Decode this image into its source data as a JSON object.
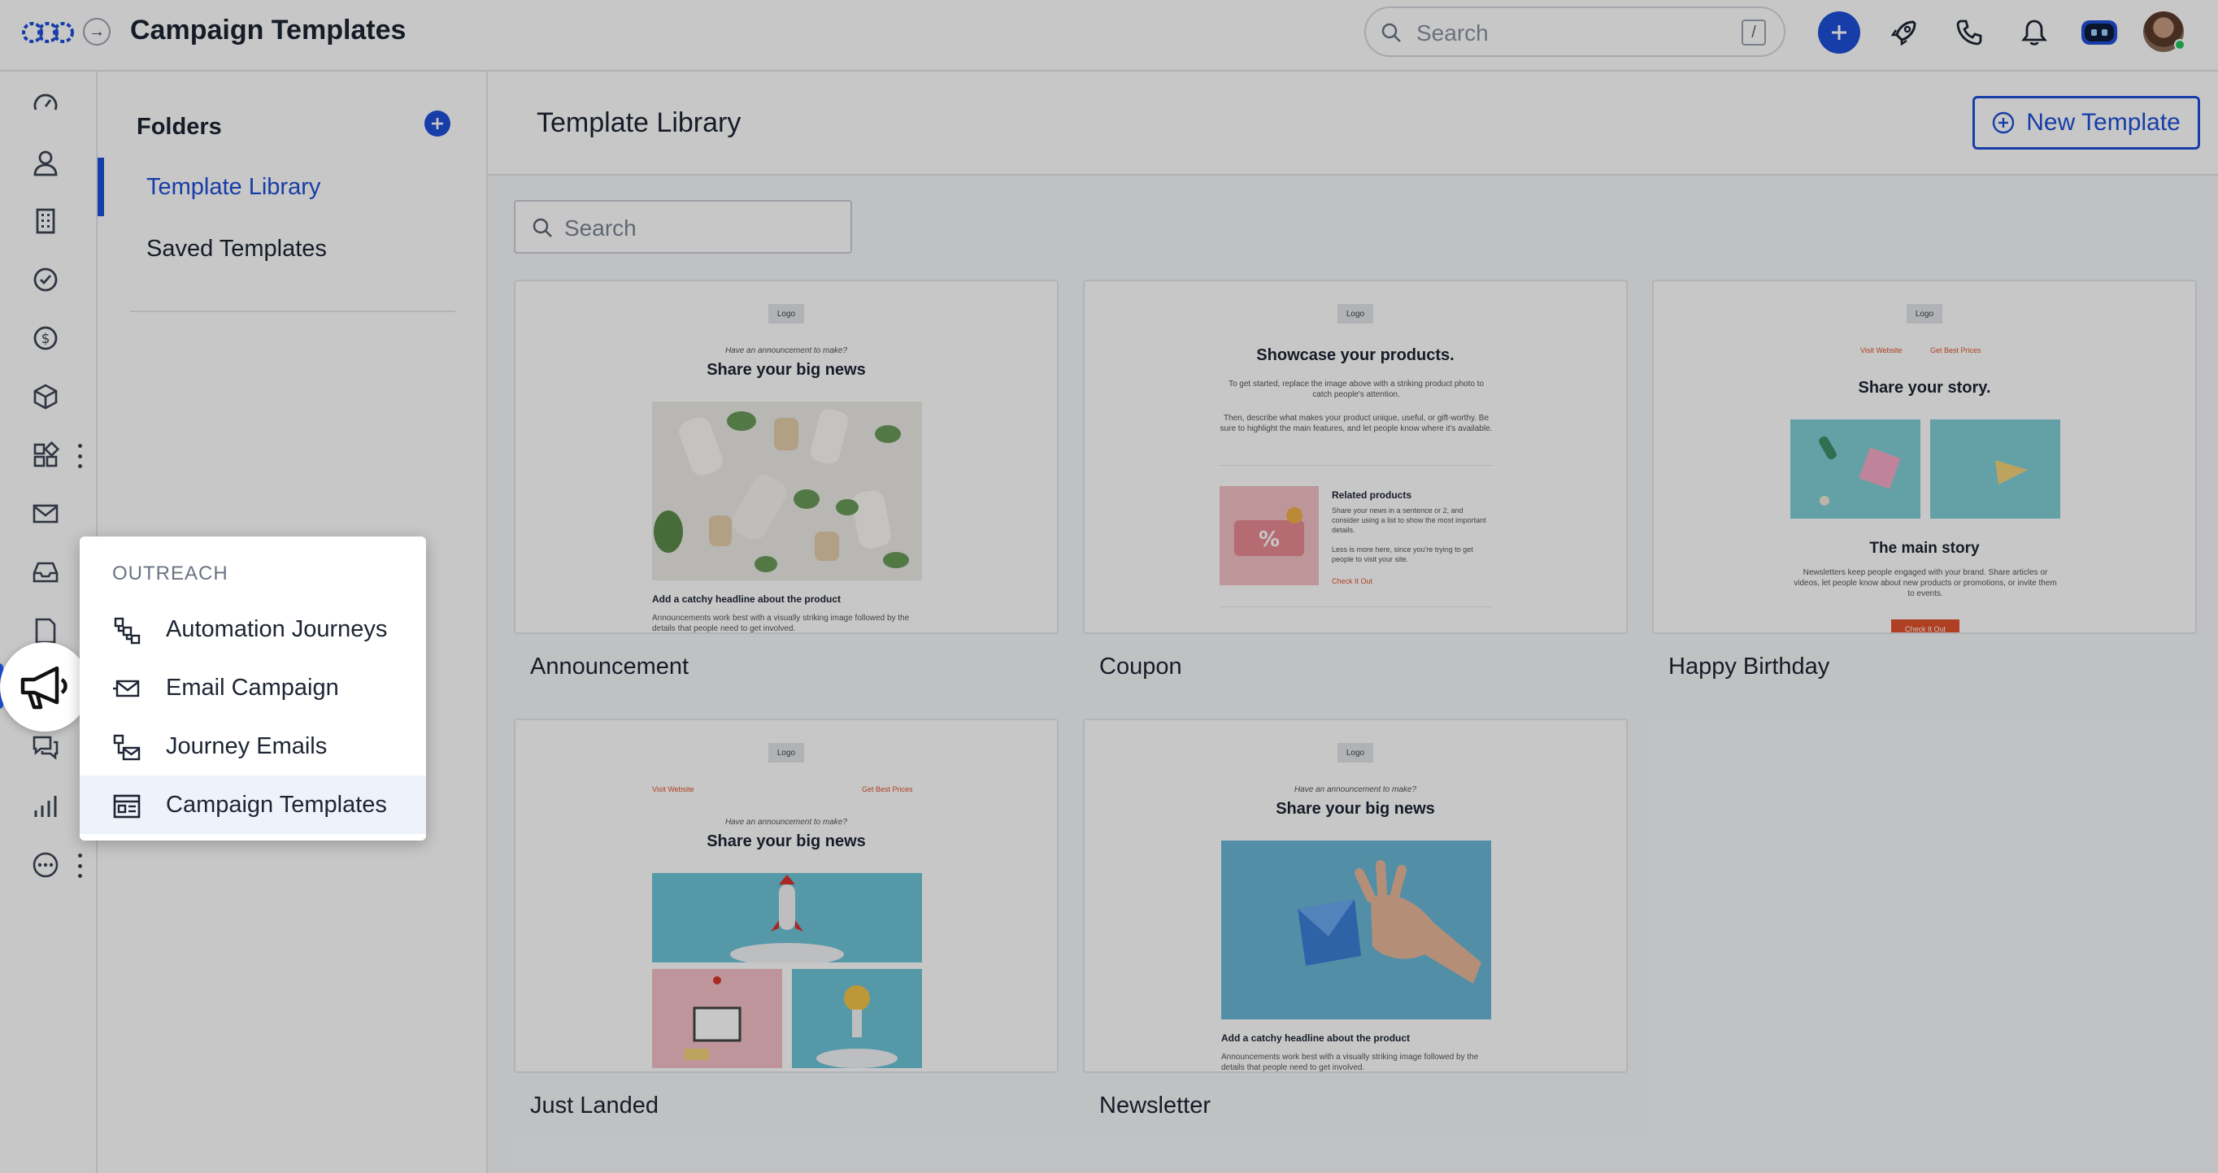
{
  "header": {
    "title": "Campaign Templates",
    "search_placeholder": "Search",
    "search_shortcut": "/"
  },
  "folders": {
    "title": "Folders",
    "items": [
      {
        "label": "Template Library",
        "active": true
      },
      {
        "label": "Saved Templates",
        "active": false
      }
    ]
  },
  "main": {
    "title": "Template Library",
    "new_template_label": "New Template",
    "search_placeholder": "Search"
  },
  "templates": [
    {
      "name": "Announcement",
      "logo": "Logo",
      "kicker": "Have an announcement to make?",
      "headline": "Share your big news",
      "subhead": "Add a catchy headline about the product",
      "body": "Announcements work best with a visually striking image followed by the details that people need to get involved."
    },
    {
      "name": "Coupon",
      "logo": "Logo",
      "headline": "Showcase your products.",
      "body1": "To get started, replace the image above with a striking product photo to catch people's attention.",
      "body2": "Then, describe what makes your product unique, useful, or gift-worthy. Be sure to highlight the main features, and let people know where it's available.",
      "related_title": "Related products",
      "related_body1": "Share your news in a sentence or 2, and consider using a list to show the most important details.",
      "related_body2": "Less is more here, since you're trying to get people to visit your site.",
      "link": "Check It Out"
    },
    {
      "name": "Happy Birthday",
      "logo": "Logo",
      "link1": "Visit Website",
      "link2": "Get Best Prices",
      "headline": "Share your story.",
      "subhead": "The main story",
      "body": "Newsletters keep people engaged with your brand. Share articles or videos, let people know about new products or promotions, or invite them to events.",
      "button": "Check It Out"
    },
    {
      "name": "Just Landed",
      "logo": "Logo",
      "link1": "Visit Website",
      "link2": "Get Best Prices",
      "kicker": "Have an announcement to make?",
      "headline": "Share your big news"
    },
    {
      "name": "Newsletter",
      "logo": "Logo",
      "kicker": "Have an announcement to make?",
      "headline": "Share your big news",
      "subhead": "Add a catchy headline about the product",
      "body": "Announcements work best with a visually striking image followed by the details that people need to get involved."
    }
  ],
  "popup": {
    "title": "OUTREACH",
    "items": [
      {
        "label": "Automation Journeys",
        "icon": "flow-icon",
        "active": false
      },
      {
        "label": "Email Campaign",
        "icon": "envelope-send-icon",
        "active": false
      },
      {
        "label": "Journey Emails",
        "icon": "journey-email-icon",
        "active": false
      },
      {
        "label": "Campaign Templates",
        "icon": "template-icon",
        "active": true
      }
    ]
  },
  "colors": {
    "accent": "#1e4fd8",
    "link_orange": "#e2532d",
    "teal_image": "#7fcfd6"
  }
}
